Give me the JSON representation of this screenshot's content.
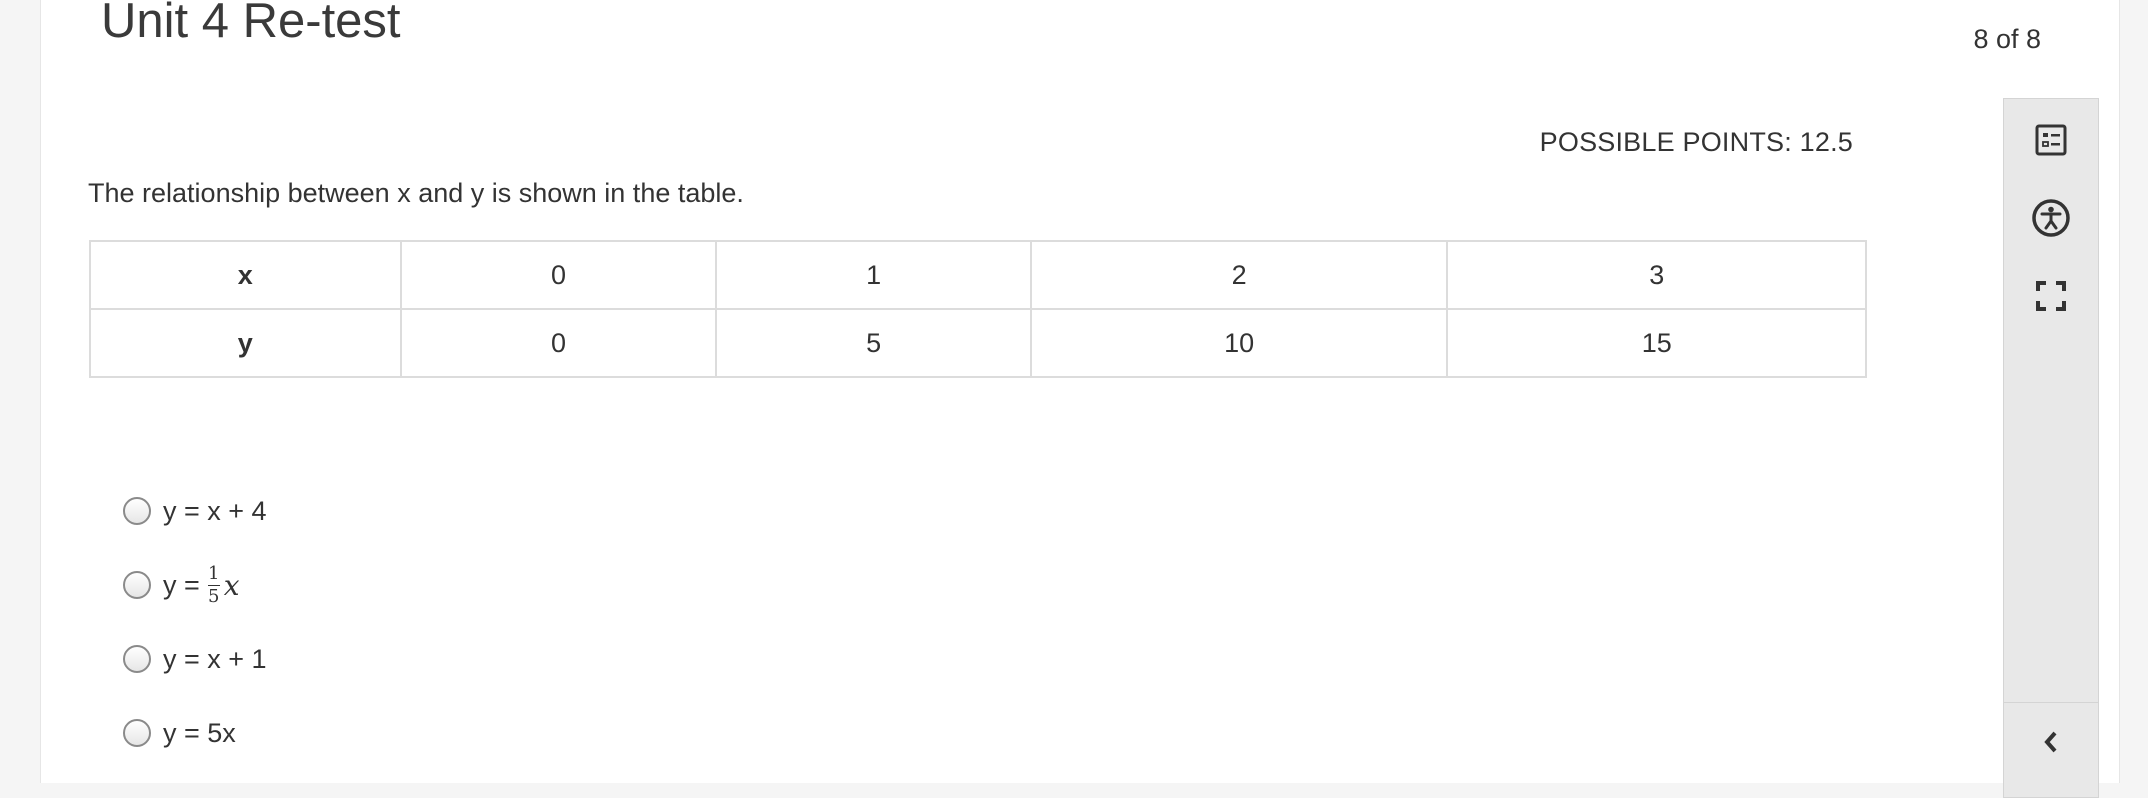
{
  "header": {
    "title": "Unit 4 Re-test",
    "counter": "8 of 8"
  },
  "question": {
    "points": "POSSIBLE POINTS: 12.5",
    "prompt": "The relationship between x and y is shown in the table.",
    "table": {
      "rows": [
        {
          "label": "x",
          "values": [
            "0",
            "1",
            "2",
            "3"
          ]
        },
        {
          "label": "y",
          "values": [
            "0",
            "5",
            "10",
            "15"
          ]
        }
      ]
    },
    "options": [
      {
        "text": "y = x + 4"
      },
      {
        "prefix": "y =",
        "numerator": "1",
        "denominator": "5",
        "variable": "x"
      },
      {
        "text": "y = x + 1"
      },
      {
        "text": "y = 5x"
      }
    ]
  },
  "sidebar": {
    "tools": [
      {
        "icon": "question-list-icon"
      },
      {
        "icon": "accessibility-icon"
      },
      {
        "icon": "fullscreen-icon"
      },
      {
        "icon": "chevron-left-icon"
      }
    ]
  },
  "colors": {
    "sidebar_bg": "#e8e8e8",
    "table_border": "#dcdcdc",
    "text": "#333333"
  }
}
